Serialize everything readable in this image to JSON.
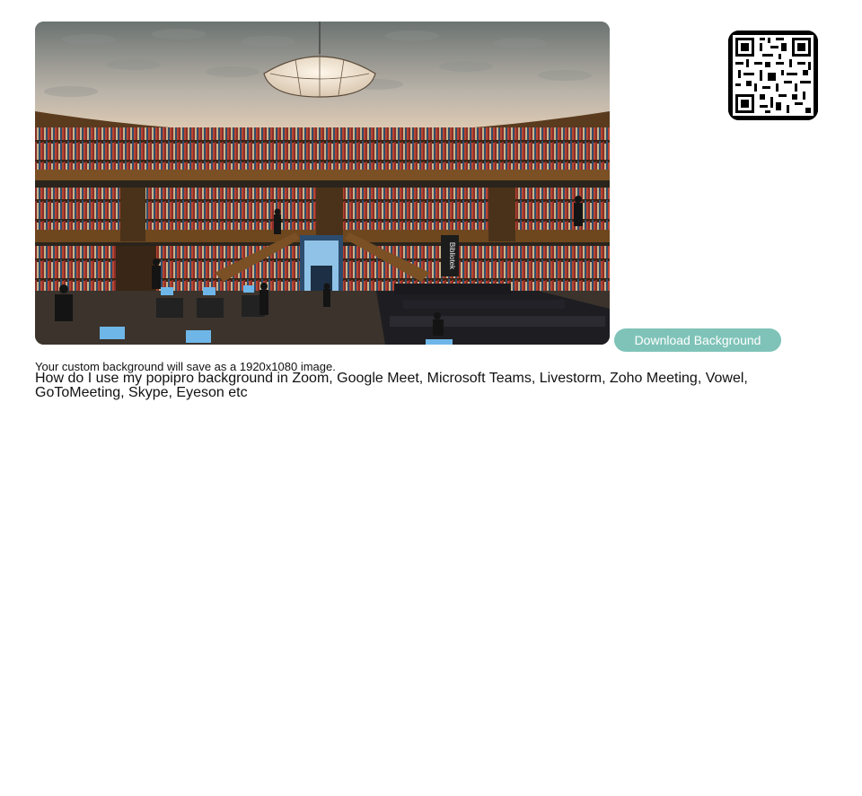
{
  "preview": {
    "alt": "Library rotunda background preview",
    "sign_text": "Bibliotek"
  },
  "qr": {
    "alt": "QR code"
  },
  "download_button": {
    "label": "Download Background"
  },
  "info": {
    "save_note": "Your custom background will save as a 1920x1080 image.",
    "howto": "How do I use my popipro background in Zoom, Google Meet, Microsoft Teams, Livestorm, Zoho Meeting, Vowel, GoToMeeting, Skype, Eyeson etc"
  },
  "colors": {
    "button_bg": "#7fc3b8",
    "button_text": "#ffffff",
    "page_bg": "#ffffff"
  }
}
